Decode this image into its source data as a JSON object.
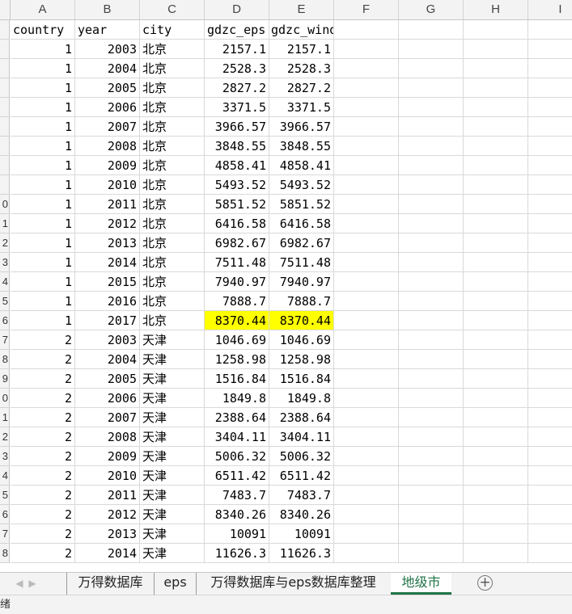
{
  "columns": [
    "A",
    "B",
    "C",
    "D",
    "E",
    "F",
    "G",
    "H",
    "I"
  ],
  "header_row": {
    "rownum": "",
    "country": "country",
    "year": "year",
    "city": "city",
    "gdzc_eps": "gdzc_eps",
    "gdzc_wind": "gdzc_wind"
  },
  "rows": [
    {
      "rownum": "",
      "country": "1",
      "year": "2003",
      "city": "北京",
      "gdzc_eps": "2157.1",
      "gdzc_wind": "2157.1"
    },
    {
      "rownum": "",
      "country": "1",
      "year": "2004",
      "city": "北京",
      "gdzc_eps": "2528.3",
      "gdzc_wind": "2528.3"
    },
    {
      "rownum": "",
      "country": "1",
      "year": "2005",
      "city": "北京",
      "gdzc_eps": "2827.2",
      "gdzc_wind": "2827.2"
    },
    {
      "rownum": "",
      "country": "1",
      "year": "2006",
      "city": "北京",
      "gdzc_eps": "3371.5",
      "gdzc_wind": "3371.5"
    },
    {
      "rownum": "",
      "country": "1",
      "year": "2007",
      "city": "北京",
      "gdzc_eps": "3966.57",
      "gdzc_wind": "3966.57"
    },
    {
      "rownum": "",
      "country": "1",
      "year": "2008",
      "city": "北京",
      "gdzc_eps": "3848.55",
      "gdzc_wind": "3848.55"
    },
    {
      "rownum": "",
      "country": "1",
      "year": "2009",
      "city": "北京",
      "gdzc_eps": "4858.41",
      "gdzc_wind": "4858.41"
    },
    {
      "rownum": "",
      "country": "1",
      "year": "2010",
      "city": "北京",
      "gdzc_eps": "5493.52",
      "gdzc_wind": "5493.52"
    },
    {
      "rownum": "0",
      "country": "1",
      "year": "2011",
      "city": "北京",
      "gdzc_eps": "5851.52",
      "gdzc_wind": "5851.52"
    },
    {
      "rownum": "1",
      "country": "1",
      "year": "2012",
      "city": "北京",
      "gdzc_eps": "6416.58",
      "gdzc_wind": "6416.58"
    },
    {
      "rownum": "2",
      "country": "1",
      "year": "2013",
      "city": "北京",
      "gdzc_eps": "6982.67",
      "gdzc_wind": "6982.67"
    },
    {
      "rownum": "3",
      "country": "1",
      "year": "2014",
      "city": "北京",
      "gdzc_eps": "7511.48",
      "gdzc_wind": "7511.48"
    },
    {
      "rownum": "4",
      "country": "1",
      "year": "2015",
      "city": "北京",
      "gdzc_eps": "7940.97",
      "gdzc_wind": "7940.97"
    },
    {
      "rownum": "5",
      "country": "1",
      "year": "2016",
      "city": "北京",
      "gdzc_eps": "7888.7",
      "gdzc_wind": "7888.7"
    },
    {
      "rownum": "6",
      "country": "1",
      "year": "2017",
      "city": "北京",
      "gdzc_eps": "8370.44",
      "gdzc_wind": "8370.44",
      "highlight": true
    },
    {
      "rownum": "7",
      "country": "2",
      "year": "2003",
      "city": "天津",
      "gdzc_eps": "1046.69",
      "gdzc_wind": "1046.69"
    },
    {
      "rownum": "8",
      "country": "2",
      "year": "2004",
      "city": "天津",
      "gdzc_eps": "1258.98",
      "gdzc_wind": "1258.98"
    },
    {
      "rownum": "9",
      "country": "2",
      "year": "2005",
      "city": "天津",
      "gdzc_eps": "1516.84",
      "gdzc_wind": "1516.84"
    },
    {
      "rownum": "0",
      "country": "2",
      "year": "2006",
      "city": "天津",
      "gdzc_eps": "1849.8",
      "gdzc_wind": "1849.8"
    },
    {
      "rownum": "1",
      "country": "2",
      "year": "2007",
      "city": "天津",
      "gdzc_eps": "2388.64",
      "gdzc_wind": "2388.64"
    },
    {
      "rownum": "2",
      "country": "2",
      "year": "2008",
      "city": "天津",
      "gdzc_eps": "3404.11",
      "gdzc_wind": "3404.11"
    },
    {
      "rownum": "3",
      "country": "2",
      "year": "2009",
      "city": "天津",
      "gdzc_eps": "5006.32",
      "gdzc_wind": "5006.32"
    },
    {
      "rownum": "4",
      "country": "2",
      "year": "2010",
      "city": "天津",
      "gdzc_eps": "6511.42",
      "gdzc_wind": "6511.42"
    },
    {
      "rownum": "5",
      "country": "2",
      "year": "2011",
      "city": "天津",
      "gdzc_eps": "7483.7",
      "gdzc_wind": "7483.7"
    },
    {
      "rownum": "6",
      "country": "2",
      "year": "2012",
      "city": "天津",
      "gdzc_eps": "8340.26",
      "gdzc_wind": "8340.26"
    },
    {
      "rownum": "7",
      "country": "2",
      "year": "2013",
      "city": "天津",
      "gdzc_eps": "10091",
      "gdzc_wind": "10091"
    },
    {
      "rownum": "8",
      "country": "2",
      "year": "2014",
      "city": "天津",
      "gdzc_eps": "11626.3",
      "gdzc_wind": "11626.3"
    }
  ],
  "highlight_color": "#ffff00",
  "sheet_tabs": [
    {
      "label": "万得数据库",
      "active": false
    },
    {
      "label": "eps",
      "active": false
    },
    {
      "label": "万得数据库与eps数据库整理",
      "active": false
    },
    {
      "label": "地级市",
      "active": true
    }
  ],
  "active_tab_color": "#217346",
  "nav_icons": [
    "prev-sheet-icon",
    "next-sheet-icon"
  ],
  "add_sheet_icon": "plus-circle-icon",
  "status_text": "绪"
}
